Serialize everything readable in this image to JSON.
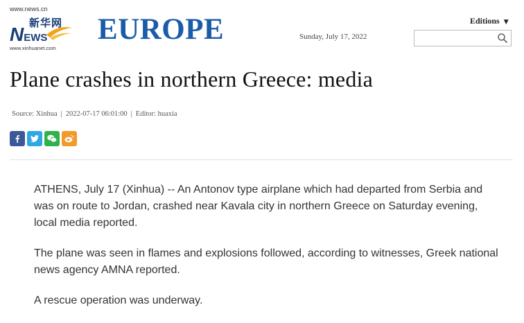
{
  "logo": {
    "url_text": "www.news.cn",
    "cn_text": "新华网",
    "news_n": "N",
    "news_ews": "EWS",
    "sub_text": "www.xinhuanet.com"
  },
  "header": {
    "section_title": "EUROPE",
    "date": "Sunday, July  17, 2022",
    "editions_label": "Editions",
    "search_value": "",
    "search_placeholder": ""
  },
  "article": {
    "headline": "Plane crashes in northern Greece: media",
    "meta": {
      "source": "Source: Xinhua",
      "datetime": "2022-07-17 06:01:00",
      "editor": "Editor: huaxia"
    },
    "share_buttons": [
      {
        "icon": "facebook-icon",
        "color": "#3b5998"
      },
      {
        "icon": "twitter-icon",
        "color": "#2fa7e3"
      },
      {
        "icon": "wechat-icon",
        "color": "#2fb24b"
      },
      {
        "icon": "weibo-icon",
        "color": "#f39a2b"
      }
    ],
    "paragraphs": [
      "ATHENS, July 17 (Xinhua) -- An Antonov type airplane which had departed from Serbia and was on route to Jordan, crashed near Kavala city in northern Greece on Saturday evening, local media reported.",
      "The plane was seen in flames and explosions followed, according to witnesses, Greek national news agency AMNA reported.",
      "A rescue operation was underway."
    ]
  },
  "colors": {
    "brand_blue": "#1b5ca8",
    "logo_orange": "#f2a21c"
  }
}
